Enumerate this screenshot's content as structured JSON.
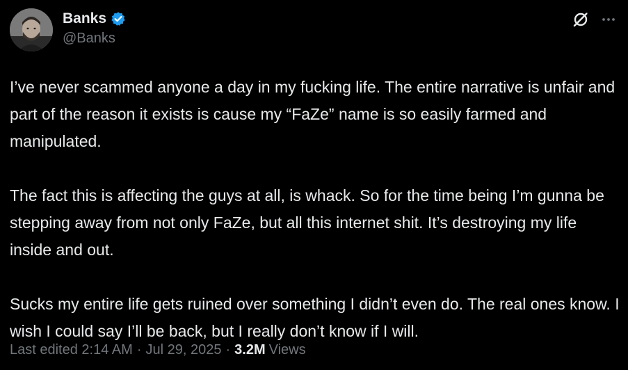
{
  "author": {
    "display_name": "Banks",
    "handle": "@Banks",
    "verified_color": "#1d9bf0"
  },
  "icons": {
    "verified": "verified-badge-icon",
    "grok": "grok-icon",
    "more": "more-icon"
  },
  "tweet": {
    "paragraphs": [
      "I’ve never scammed anyone a day in my fucking life. The entire narrative is unfair and part of the reason it exists is cause my “FaZe” name is so easily farmed and manipulated.",
      "The fact this is affecting the guys at all, is whack. So for the time being I’m gunna be stepping away from not only FaZe, but all this internet shit. It’s destroying my life inside and out.",
      "Sucks my entire life gets ruined over something I didn’t even do. The real ones know. I wish I could say I’ll be back, but I really don’t know if I will."
    ]
  },
  "meta": {
    "edited_label": "Last edited",
    "time": "2:14 AM",
    "date": "Jul 29, 2025",
    "separator": "·",
    "views_count": "3.2M",
    "views_label": "Views"
  },
  "colors": {
    "background": "#000000",
    "text_primary": "#e7e9ea",
    "text_secondary": "#71767b"
  }
}
